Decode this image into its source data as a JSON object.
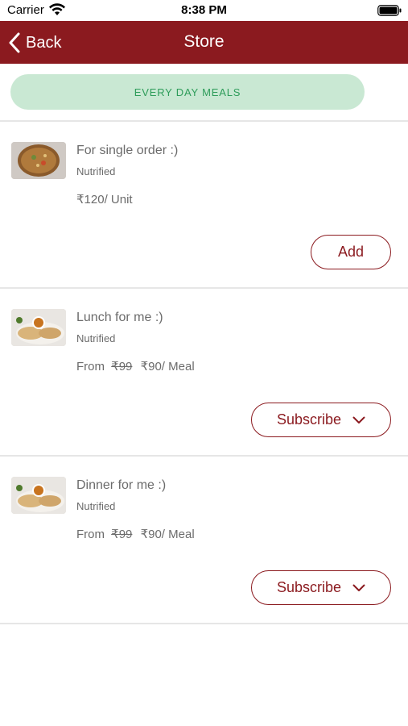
{
  "status": {
    "carrier": "Carrier",
    "time": "8:38 PM"
  },
  "nav": {
    "back_label": "Back",
    "title": "Store"
  },
  "filter": {
    "label": "EVERY DAY MEALS"
  },
  "products": [
    {
      "name": "For single order :)",
      "brand": "Nutrified",
      "price_prefix": "",
      "original_price": "",
      "price": "₹120/ Unit",
      "action_label": "Add",
      "action_icon": ""
    },
    {
      "name": "Lunch for me :)",
      "brand": "Nutrified",
      "price_prefix": "From",
      "original_price": "₹99",
      "price": "₹90/ Meal",
      "action_label": "Subscribe",
      "action_icon": "chevron-down-icon"
    },
    {
      "name": "Dinner for me :)",
      "brand": "Nutrified",
      "price_prefix": "From",
      "original_price": "₹99",
      "price": "₹90/ Meal",
      "action_label": "Subscribe",
      "action_icon": "chevron-down-icon"
    }
  ],
  "colors": {
    "brand": "#8b1a1f",
    "pill_bg": "#c9e8d3",
    "pill_text": "#2e9c5a"
  }
}
